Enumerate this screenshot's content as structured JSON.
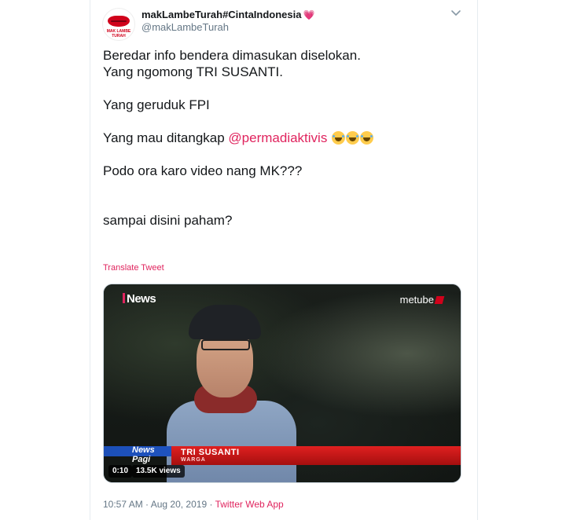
{
  "author": {
    "display_name": "makLambeTurah#CintaIndonesia",
    "heart_emoji": "💗",
    "handle": "@makLambeTurah",
    "avatar_brand": "MAK LAMBE TURAH"
  },
  "tweet": {
    "lines": [
      "Beredar info bendera dimasukan diselokan.",
      "Yang ngomong TRI SUSANTI.",
      "",
      "Yang geruduk FPI",
      "",
      "Yang mau ditangkap "
    ],
    "mention": "@permadiaktivis",
    "emoji_icon": "rolling-on-floor-laughing-emoji",
    "emoji_count": 3,
    "line_after_mention": "Podo ora karo video nang MK???",
    "last_line": "sampai disini paham?"
  },
  "translate_label": "Translate Tweet",
  "video": {
    "channel_logo": "News",
    "watermark": "metube",
    "lower_third_brand": "News",
    "lower_third_sub": "Pagi",
    "lower_third_name": "TRI SUSANTI",
    "lower_third_role": "WARGA",
    "duration": "0:10",
    "views": "13.5K views"
  },
  "meta": {
    "time": "10:57 AM",
    "separator1": " · ",
    "date": "Aug 20, 2019",
    "separator2": " · ",
    "app": "Twitter Web App"
  },
  "colors": {
    "accent": "#e0245e",
    "text": "#14171a",
    "muted": "#657786"
  }
}
